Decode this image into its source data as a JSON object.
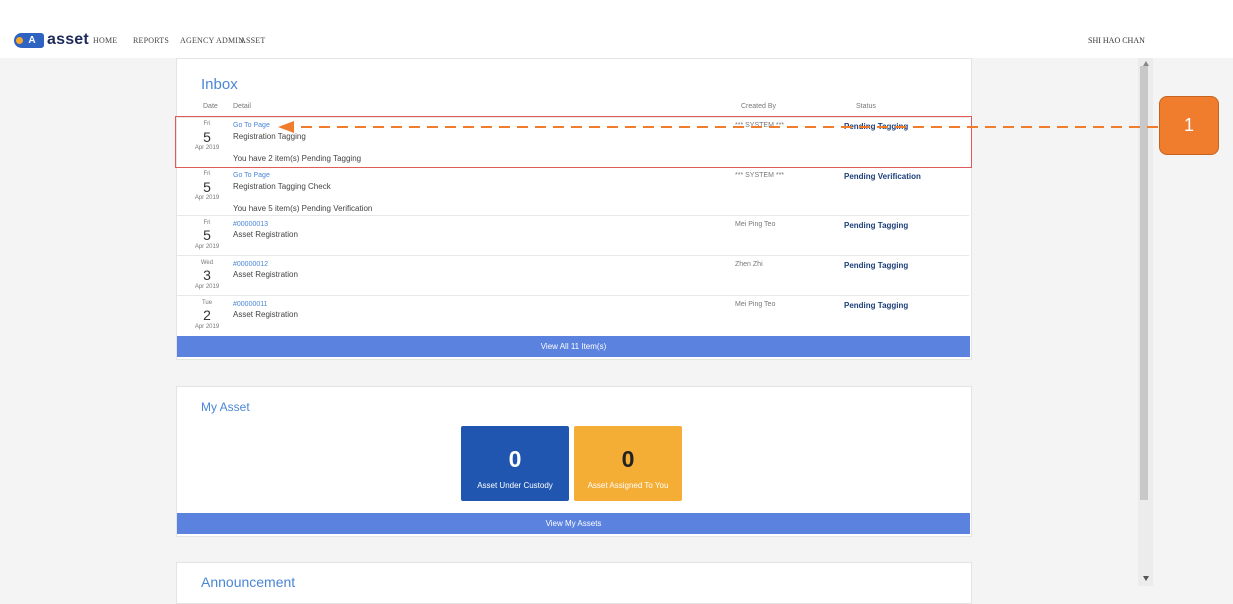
{
  "app": {
    "logo_letter": "A",
    "logo_text": "asset"
  },
  "nav": {
    "home": "HOME",
    "reports": "REPORTS",
    "agency_admin": "AGENCY ADMIN",
    "asset": "ASSET"
  },
  "user": {
    "name": "SHI HAO CHAN"
  },
  "inbox": {
    "title": "Inbox",
    "headers": {
      "date": "Date",
      "detail": "Detail",
      "created_by": "Created By",
      "status": "Status"
    },
    "rows": [
      {
        "dow": "Fri",
        "day": "5",
        "month": "Apr 2019",
        "link": "Go To Page",
        "title": "Registration Tagging",
        "note": "You have 2 item(s) Pending Tagging",
        "created_by": "*** SYSTEM ***",
        "status": "Pending Tagging"
      },
      {
        "dow": "Fri",
        "day": "5",
        "month": "Apr 2019",
        "link": "Go To Page",
        "title": "Registration Tagging Check",
        "note": "You have 5 item(s) Pending Verification",
        "created_by": "*** SYSTEM ***",
        "status": "Pending Verification"
      },
      {
        "dow": "Fri",
        "day": "5",
        "month": "Apr 2019",
        "link": "#00000013",
        "title": "Asset Registration",
        "note": "",
        "created_by": "Mei Ping Teo",
        "status": "Pending Tagging"
      },
      {
        "dow": "Wed",
        "day": "3",
        "month": "Apr 2019",
        "link": "#00000012",
        "title": "Asset Registration",
        "note": "",
        "created_by": "Zhen Zhi",
        "status": "Pending Tagging"
      },
      {
        "dow": "Tue",
        "day": "2",
        "month": "Apr 2019",
        "link": "#00000011",
        "title": "Asset Registration",
        "note": "",
        "created_by": "Mei Ping Teo",
        "status": "Pending Tagging"
      }
    ],
    "view_all": "View All 11 Item(s)"
  },
  "my_asset": {
    "title": "My Asset",
    "custody_count": "0",
    "custody_label": "Asset Under Custody",
    "assigned_count": "0",
    "assigned_label": "Asset Assigned To You",
    "view_label": "View My Assets"
  },
  "announcement": {
    "title": "Announcement"
  },
  "annotation": {
    "label": "1"
  },
  "colors": {
    "accent": "#4a86d6",
    "bar": "#5a82de",
    "custody_tile": "#2056b0",
    "assigned_tile": "#f4ad35",
    "callout": "#ef7d2d",
    "highlight_box": "#e05a5a"
  }
}
